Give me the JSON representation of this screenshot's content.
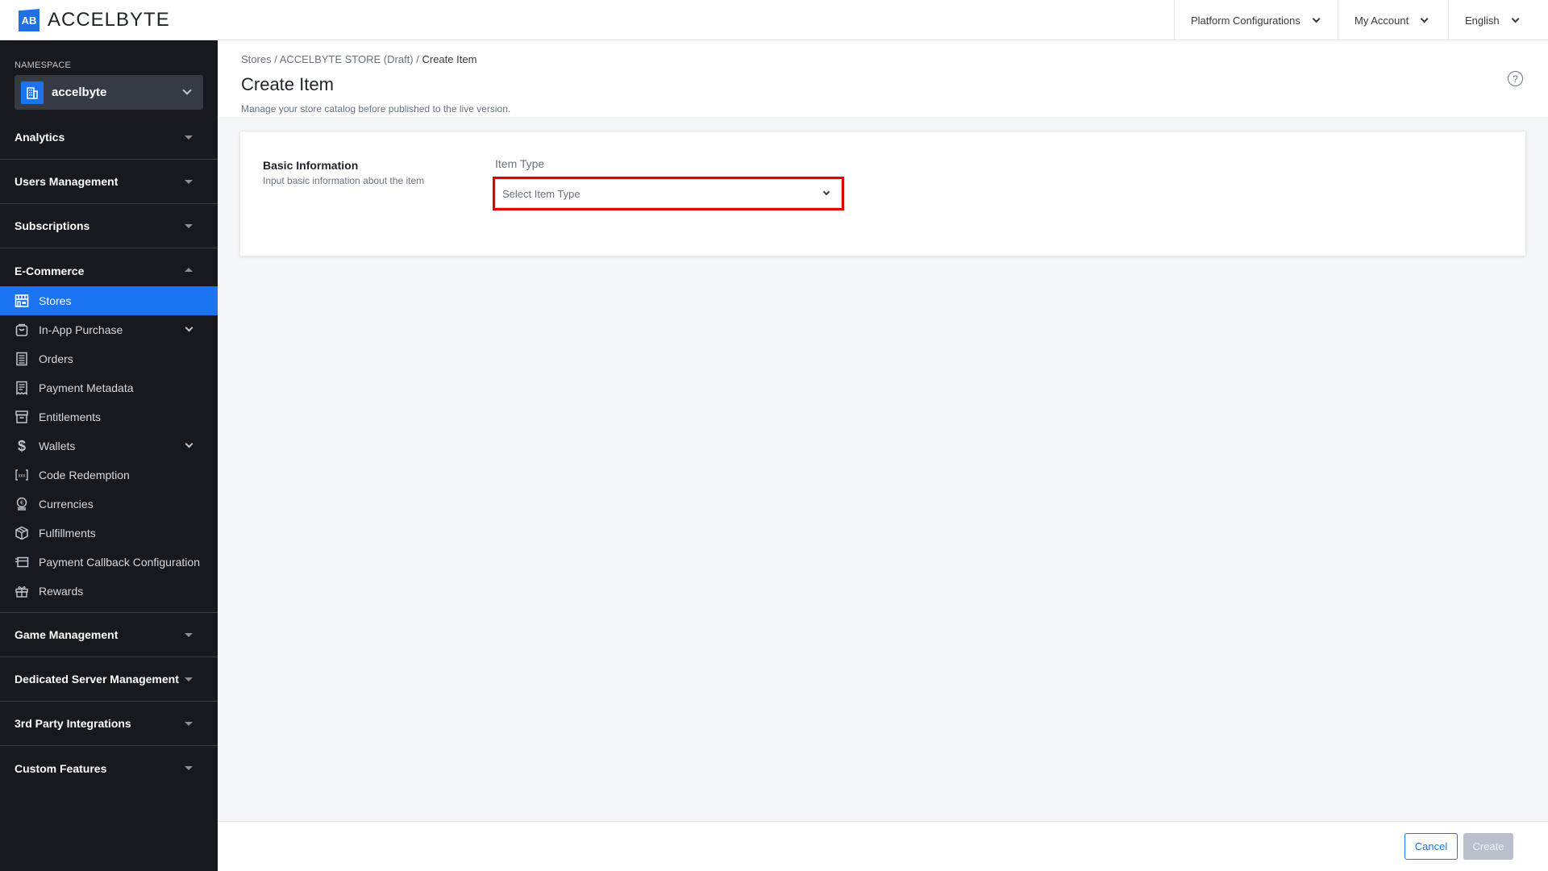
{
  "header": {
    "logo_text": "ACCELBYTE",
    "logo_mark": "AB",
    "menus": [
      {
        "label": "Platform Configurations"
      },
      {
        "label": "My Account"
      },
      {
        "label": "English"
      }
    ]
  },
  "sidebar": {
    "namespace_label": "NAMESPACE",
    "namespace_value": "accelbyte",
    "sections": [
      {
        "label": "Analytics",
        "expanded": false
      },
      {
        "label": "Users Management",
        "expanded": false
      },
      {
        "label": "Subscriptions",
        "expanded": false
      },
      {
        "label": "E-Commerce",
        "expanded": true
      },
      {
        "label": "Game Management",
        "expanded": false
      },
      {
        "label": "Dedicated Server Management",
        "expanded": false
      },
      {
        "label": "3rd Party Integrations",
        "expanded": false
      },
      {
        "label": "Custom Features",
        "expanded": false
      }
    ],
    "ecommerce_items": [
      {
        "label": "Stores",
        "icon": "store-icon",
        "active": true
      },
      {
        "label": "In-App Purchase",
        "icon": "shopping-bag-icon",
        "has_submenu": true
      },
      {
        "label": "Orders",
        "icon": "receipt-icon"
      },
      {
        "label": "Payment Metadata",
        "icon": "document-icon"
      },
      {
        "label": "Entitlements",
        "icon": "archive-box-icon"
      },
      {
        "label": "Wallets",
        "icon": "dollar-icon",
        "has_submenu": true
      },
      {
        "label": "Code Redemption",
        "icon": "code-brackets-icon"
      },
      {
        "label": "Currencies",
        "icon": "coin-stack-icon"
      },
      {
        "label": "Fulfillments",
        "icon": "cube-icon"
      },
      {
        "label": "Payment Callback Configuration",
        "icon": "card-callback-icon"
      },
      {
        "label": "Rewards",
        "icon": "gift-icon"
      }
    ]
  },
  "page": {
    "breadcrumb": [
      "Stores",
      "ACCELBYTE STORE (Draft)",
      "Create Item"
    ],
    "breadcrumb_separator": "/",
    "title": "Create Item",
    "subtitle": "Manage your store catalog before published to the live version.",
    "help_icon": "?"
  },
  "form": {
    "section_title": "Basic Information",
    "section_desc": "Input basic information about the item",
    "item_type_label": "Item Type",
    "item_type_placeholder": "Select Item Type",
    "item_type_value": ""
  },
  "footer": {
    "cancel_label": "Cancel",
    "create_label": "Create",
    "create_disabled": true
  },
  "colors": {
    "accent": "#1a73f0",
    "sidebar_bg": "#17191e",
    "highlight_border": "#e00000",
    "disabled_button": "#b9c0cb"
  }
}
